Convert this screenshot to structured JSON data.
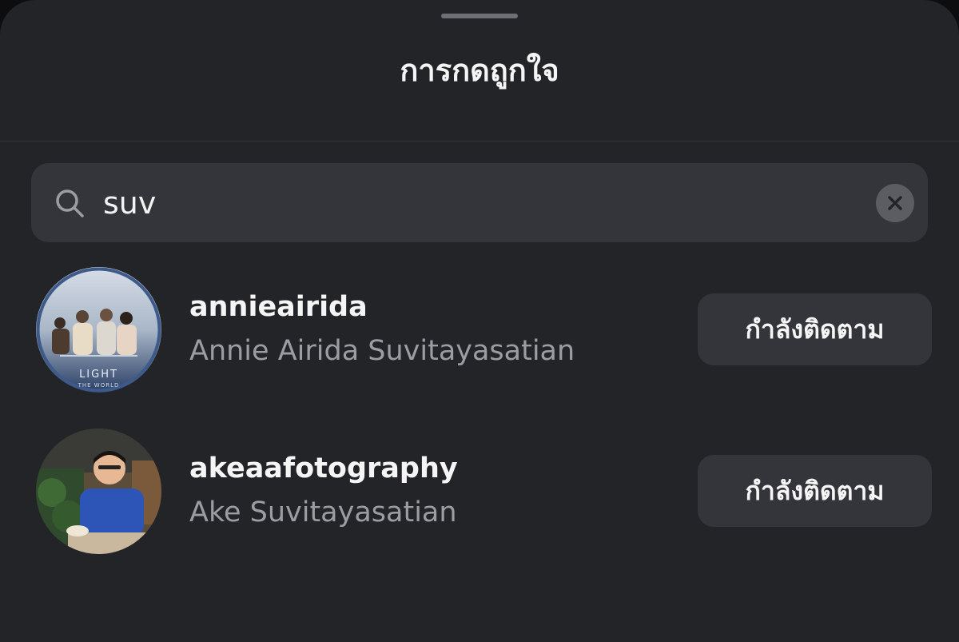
{
  "header": {
    "title": "การกดถูกใจ"
  },
  "search": {
    "query": "suv",
    "search_icon": "search-icon",
    "clear_icon": "close-icon"
  },
  "results": [
    {
      "username": "annieairida",
      "full_name": "Annie Airida Suvitayasatian",
      "button_label": "กำลังติดตาม",
      "avatar_text_line1": "LIGHT",
      "avatar_text_line2": "THE WORLD"
    },
    {
      "username": "akeaafotography",
      "full_name": "Ake Suvitayasatian",
      "button_label": "กำลังติดตาม"
    }
  ],
  "colors": {
    "sheet_bg": "#232428",
    "field_bg": "#34353a",
    "primary_text": "#f5f5f5",
    "secondary_text": "#9c9da2"
  }
}
